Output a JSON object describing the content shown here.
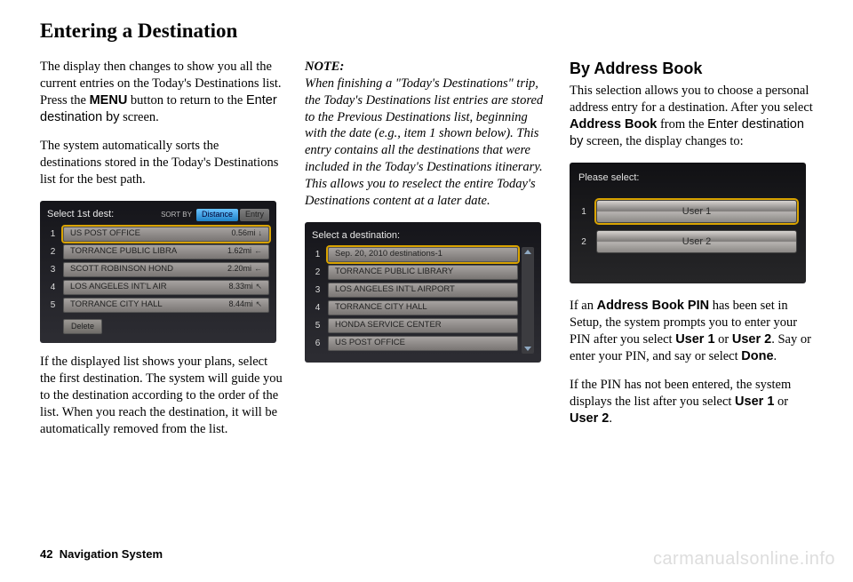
{
  "page_title": "Entering a Destination",
  "footer": {
    "page_number": "42",
    "section": "Navigation System"
  },
  "watermark": "carmanualsonline.info",
  "col1": {
    "p1a": "The display then changes to show you all the current entries on the Today's Destinations list. Press the ",
    "p1_menu": "MENU",
    "p1b": " button to return to the ",
    "p1_enter": "Enter destination by",
    "p1c": " screen.",
    "p2": "The system automatically sorts the destinations stored in the Today's Destinations list for the best path.",
    "p3": "If the displayed list shows your plans, select the first destination. The system will guide you to the destination according to the order of the list. When you reach the destination, it will be automatically removed from the list."
  },
  "col2": {
    "note_label": "NOTE:",
    "note_body": "When finishing a \"Today's Destinations\" trip, the Today's Destinations list entries are stored to the Previous Destinations list, beginning with the date (e.g., item 1 shown below). This entry contains all the destinations that were included in the Today's Destinations itinerary. This allows you to reselect the entire Today's Destinations content at a later date."
  },
  "col3": {
    "heading": "By Address Book",
    "p1a": "This selection allows you to choose a personal address entry for a destination. After you select ",
    "p1_ab": "Address Book",
    "p1b": " from the ",
    "p1_enter": "Enter destination by",
    "p1c": " screen, the display changes to:",
    "p2a": "If an ",
    "p2_pin": "Address Book PIN",
    "p2b": " has been set in Setup, the system prompts you to enter your PIN after you select ",
    "p2_u1": "User 1",
    "p2c": " or ",
    "p2_u2": "User 2",
    "p2d": ". Say or enter your PIN, and say or select ",
    "p2_done": "Done",
    "p2e": ".",
    "p3a": "If the PIN has not been entered, the system displays the list after you select ",
    "p3_u1": "User 1",
    "p3b": " or ",
    "p3_u2": "User 2",
    "p3c": "."
  },
  "screen1": {
    "title": "Select 1st dest:",
    "sort_label": "SORT BY",
    "tab_distance": "Distance",
    "tab_entry": "Entry",
    "delete": "Delete",
    "rows": [
      {
        "n": "1",
        "label": "US POST OFFICE",
        "dist": "0.56mi",
        "arrow": "↓"
      },
      {
        "n": "2",
        "label": "TORRANCE PUBLIC LIBRA",
        "dist": "1.62mi",
        "arrow": "←"
      },
      {
        "n": "3",
        "label": "SCOTT ROBINSON HOND",
        "dist": "2.20mi",
        "arrow": "←"
      },
      {
        "n": "4",
        "label": "LOS ANGELES INT'L AIR",
        "dist": "8.33mi",
        "arrow": "↖"
      },
      {
        "n": "5",
        "label": "TORRANCE CITY HALL",
        "dist": "8.44mi",
        "arrow": "↖"
      }
    ]
  },
  "screen2": {
    "title": "Select a destination:",
    "rows": [
      {
        "n": "1",
        "label": "Sep. 20, 2010 destinations-1"
      },
      {
        "n": "2",
        "label": "TORRANCE PUBLIC LIBRARY"
      },
      {
        "n": "3",
        "label": "LOS ANGELES INT'L AIRPORT"
      },
      {
        "n": "4",
        "label": "TORRANCE CITY HALL"
      },
      {
        "n": "5",
        "label": "HONDA SERVICE CENTER"
      },
      {
        "n": "6",
        "label": "US POST OFFICE"
      }
    ]
  },
  "screen3": {
    "title": "Please select:",
    "rows": [
      {
        "n": "1",
        "label": "User 1"
      },
      {
        "n": "2",
        "label": "User 2"
      }
    ]
  }
}
